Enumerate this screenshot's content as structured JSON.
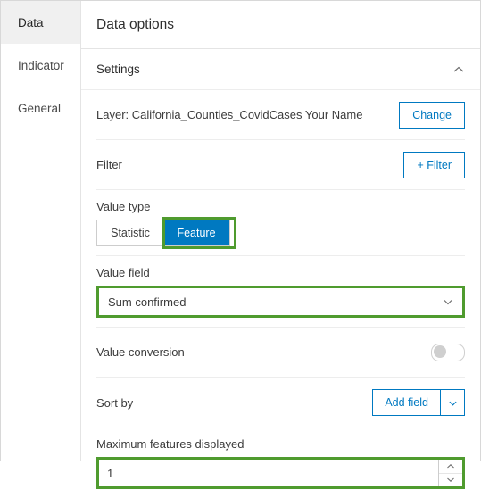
{
  "sidebar": {
    "items": [
      {
        "label": "Data",
        "active": true
      },
      {
        "label": "Indicator",
        "active": false
      },
      {
        "label": "General",
        "active": false
      }
    ]
  },
  "panel": {
    "title": "Data options",
    "section": {
      "title": "Settings",
      "collapse_icon": "chevron-up-icon"
    },
    "layer_row": {
      "label": "Layer: California_Counties_CovidCases Your Name",
      "button": "Change"
    },
    "filter_row": {
      "label": "Filter",
      "button": "+ Filter"
    },
    "value_type": {
      "label": "Value type",
      "options": [
        "Statistic",
        "Feature"
      ],
      "selected": "Feature"
    },
    "value_field": {
      "label": "Value field",
      "value": "Sum confirmed",
      "caret_icon": "chevron-down-icon"
    },
    "value_conversion": {
      "label": "Value conversion",
      "state": "off"
    },
    "sort_by": {
      "label": "Sort by",
      "button": "Add field",
      "caret_icon": "chevron-down-icon"
    },
    "max_features": {
      "label": "Maximum features displayed",
      "value": "1",
      "up_icon": "caret-up-icon",
      "down_icon": "caret-down-icon"
    }
  },
  "colors": {
    "accent": "#0079c1",
    "highlight": "#4f9b2e",
    "active_nav_bg": "#f0f0f0"
  }
}
